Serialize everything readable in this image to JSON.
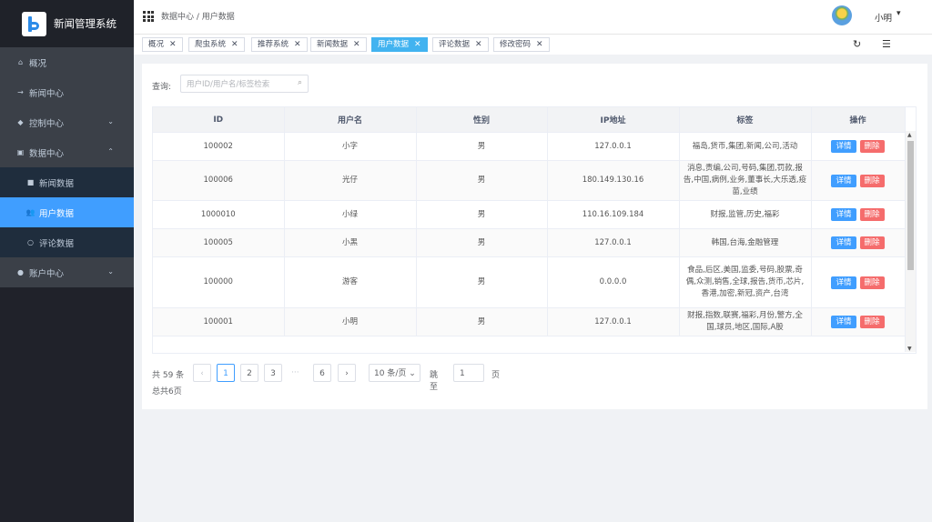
{
  "app": {
    "title": "新闻管理系统"
  },
  "sidebar": {
    "items": [
      {
        "label": "概况",
        "icon": "home-icon"
      },
      {
        "label": "新闻中心",
        "icon": "arrow-right-icon"
      },
      {
        "label": "控制中心",
        "icon": "cube-icon"
      },
      {
        "label": "数据中心",
        "icon": "database-icon"
      },
      {
        "label": "新闻数据",
        "icon": "table-icon"
      },
      {
        "label": "用户数据",
        "icon": "users-icon"
      },
      {
        "label": "评论数据",
        "icon": "comment-icon"
      },
      {
        "label": "账户中心",
        "icon": "account-icon"
      }
    ]
  },
  "header": {
    "breadcrumb": "数据中心 / 用户数据",
    "username": "小明"
  },
  "tabs": [
    "概况",
    "爬虫系统",
    "推荐系统",
    "新闻数据",
    "用户数据",
    "评论数据",
    "修改密码"
  ],
  "query": {
    "label": "查询:",
    "placeholder": "用户ID/用户名/标签检索",
    "value": ""
  },
  "table": {
    "columns": [
      "ID",
      "用户名",
      "性别",
      "IP地址",
      "标签",
      "操作"
    ],
    "rows": [
      {
        "id": "100002",
        "name": "小字",
        "gender": "男",
        "ip": "127.0.0.1",
        "tags": "福岛,货币,集团,新闻,公司,活动"
      },
      {
        "id": "100006",
        "name": "光仔",
        "gender": "男",
        "ip": "180.149.130.16",
        "tags": "消息,责编,公司,号码,集团,罚款,报告,中国,病例,业务,董事长,大乐透,疫苗,业绩"
      },
      {
        "id": "1000010",
        "name": "小绿",
        "gender": "男",
        "ip": "110.16.109.184",
        "tags": "财报,监管,历史,福彩"
      },
      {
        "id": "100005",
        "name": "小黑",
        "gender": "男",
        "ip": "127.0.0.1",
        "tags": "韩国,台海,金融管理"
      },
      {
        "id": "100000",
        "name": "游客",
        "gender": "男",
        "ip": "0.0.0.0",
        "tags": "食品,后区,美国,监委,号码,股票,奇偶,众测,销售,全球,报告,货币,芯片,香港,加密,新冠,资产,台湾"
      },
      {
        "id": "100001",
        "name": "小明",
        "gender": "男",
        "ip": "127.0.0.1",
        "tags": "财报,指数,联赛,福彩,月份,警方,全国,球员,地区,国际,A股"
      }
    ],
    "detail_label": "详情",
    "delete_label": "删除"
  },
  "pager": {
    "total": "共 59 条",
    "pages": [
      "1",
      "2",
      "3",
      "6"
    ],
    "ellipsis": "···",
    "page_size": "10 条/页",
    "jump_label": "跳至",
    "jump_value": "1",
    "page_unit": "页",
    "page_count": "总共6页"
  }
}
